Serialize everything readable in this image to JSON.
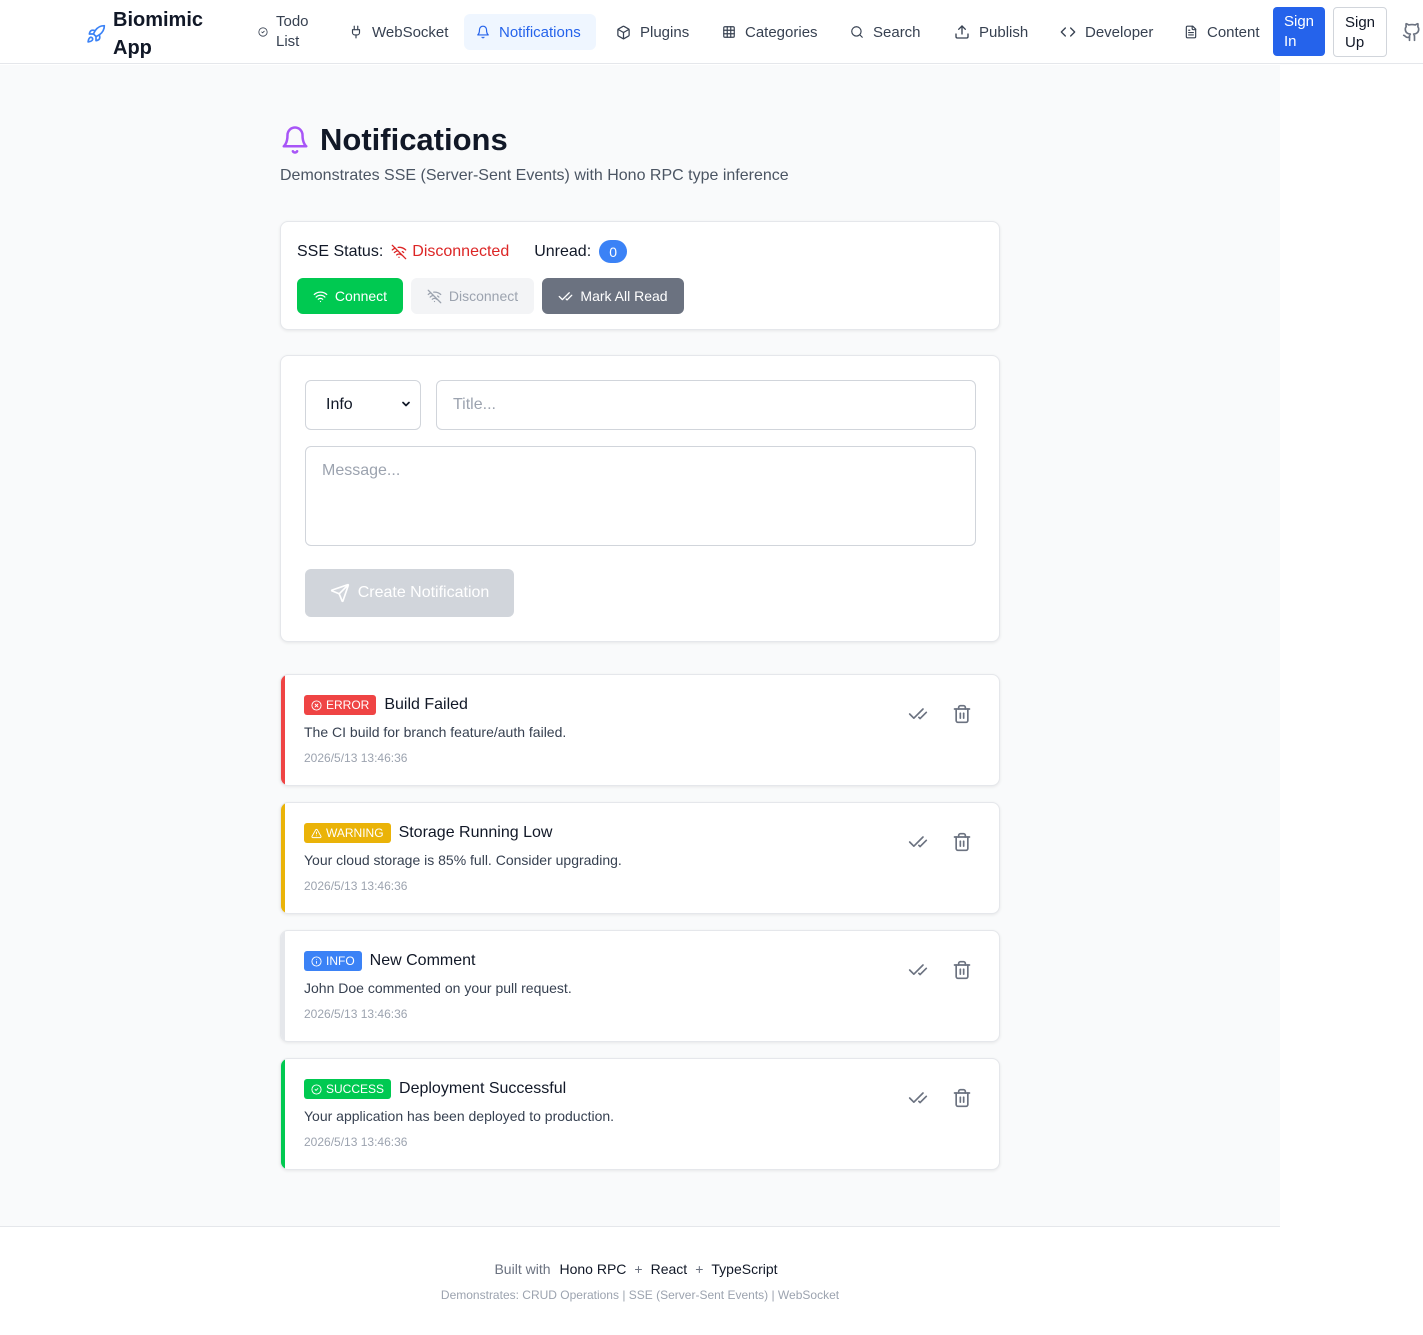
{
  "app": {
    "name": "Biomimic App"
  },
  "nav": {
    "todo": "Todo List",
    "websocket": "WebSocket",
    "notifications": "Notifications",
    "plugins": "Plugins",
    "categories": "Categories",
    "search": "Search",
    "publish": "Publish",
    "developer": "Developer",
    "content": "Content",
    "active": "notifications"
  },
  "auth": {
    "sign_in": "Sign In",
    "sign_up": "Sign Up"
  },
  "page": {
    "title": "Notifications",
    "subtitle": "Demonstrates SSE (Server-Sent Events) with Hono RPC type inference"
  },
  "status": {
    "sse_label": "SSE Status:",
    "sse_value": "Disconnected",
    "unread_label": "Unread:",
    "unread_count": "0",
    "connect": "Connect",
    "disconnect": "Disconnect",
    "mark_all_read": "Mark All Read"
  },
  "form": {
    "type_selected": "Info",
    "title_placeholder": "Title...",
    "message_placeholder": "Message...",
    "create_button": "Create Notification"
  },
  "notifications": [
    {
      "type": "ERROR",
      "title": "Build Failed",
      "message": "The CI build for branch feature/auth failed.",
      "time": "2026/5/13 13:46:36",
      "color": "#ef4444"
    },
    {
      "type": "WARNING",
      "title": "Storage Running Low",
      "message": "Your cloud storage is 85% full. Consider upgrading.",
      "time": "2026/5/13 13:46:36",
      "color": "#eab308"
    },
    {
      "type": "INFO",
      "title": "New Comment",
      "message": "John Doe commented on your pull request.",
      "time": "2026/5/13 13:46:36",
      "color": "#3b82f6"
    },
    {
      "type": "SUCCESS",
      "title": "Deployment Successful",
      "message": "Your application has been deployed to production.",
      "time": "2026/5/13 13:46:36",
      "color": "#00c951"
    }
  ],
  "footer": {
    "built_with": "Built with",
    "tech": [
      "Hono RPC",
      "React",
      "TypeScript"
    ],
    "plus": "+",
    "demonstrates": "Demonstrates: CRUD Operations | SSE (Server-Sent Events) | WebSocket"
  },
  "colors": {
    "accent": "#2563eb",
    "connect": "#00c951",
    "error": "#ef4444",
    "warning": "#eab308",
    "info": "#3b82f6",
    "success": "#00c951"
  }
}
